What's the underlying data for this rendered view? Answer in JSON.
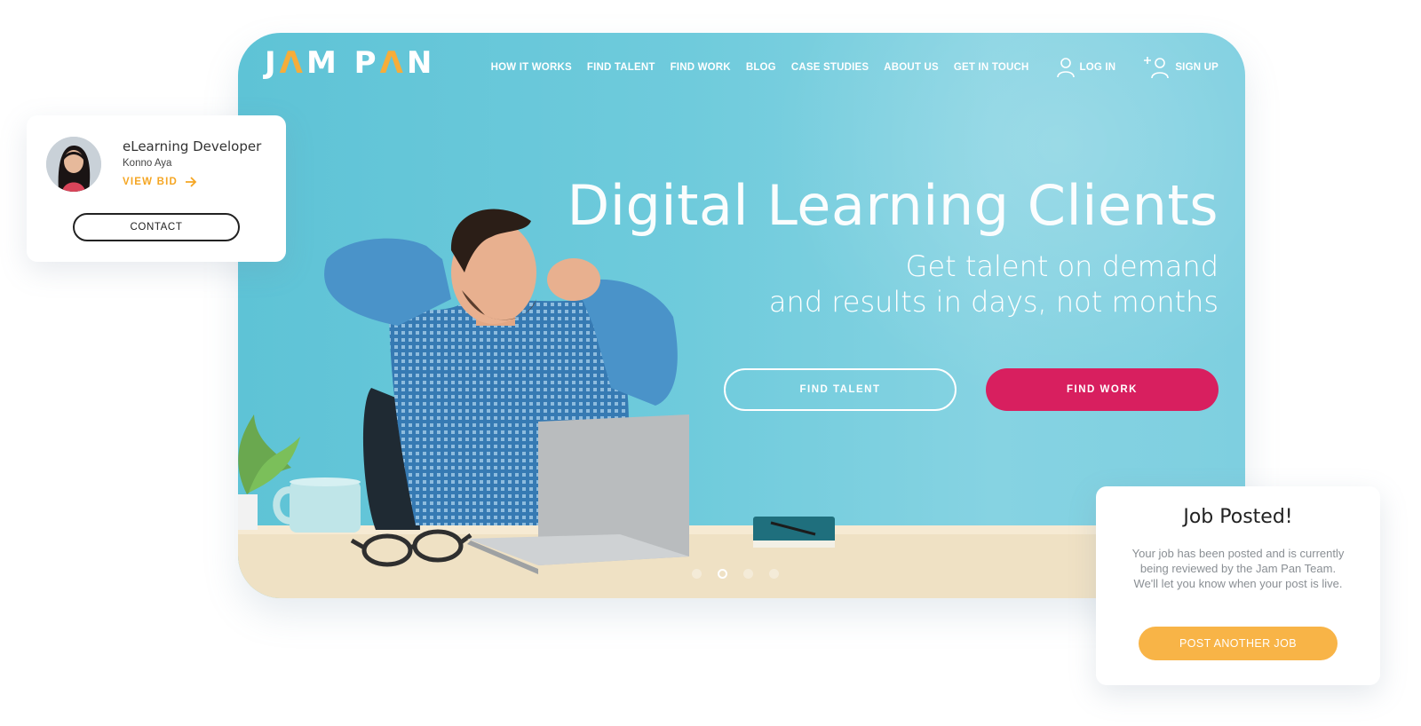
{
  "logo": {
    "part1": "J",
    "accent1": "Λ",
    "part2": "M P",
    "accent2": "Λ",
    "part3": "N"
  },
  "nav": {
    "items": [
      "HOW IT WORKS",
      "FIND TALENT",
      "FIND WORK",
      "BLOG",
      "CASE STUDIES",
      "ABOUT US",
      "GET IN TOUCH"
    ],
    "login_label": "LOG IN",
    "signup_label": "SIGN UP",
    "login_icon": "user-icon",
    "signup_icon": "add-user-icon"
  },
  "hero": {
    "title": "Digital Learning Clients",
    "subtitle_line1": "Get talent on demand",
    "subtitle_line2": "and results in days, not months",
    "find_talent_label": "FIND TALENT",
    "find_work_label": "FIND WORK",
    "slide_count": 4,
    "active_slide": 2
  },
  "dev_card": {
    "title": "eLearning Developer",
    "name": "Konno Aya",
    "view_bid_label": "VIEW BID",
    "contact_label": "CONTACT"
  },
  "job_card": {
    "title": "Job Posted!",
    "text_line1": "Your job has been posted and is currently",
    "text_line2": "being reviewed by the Jam Pan Team.",
    "text_line3": "We'll let you know when your post is live.",
    "button_label": "POST ANOTHER JOB"
  },
  "colors": {
    "brand_accent": "#f6ad3a",
    "find_work": "#d81f5f",
    "hero_bg": "#6fcbdc",
    "post_button": "#f8b447"
  }
}
